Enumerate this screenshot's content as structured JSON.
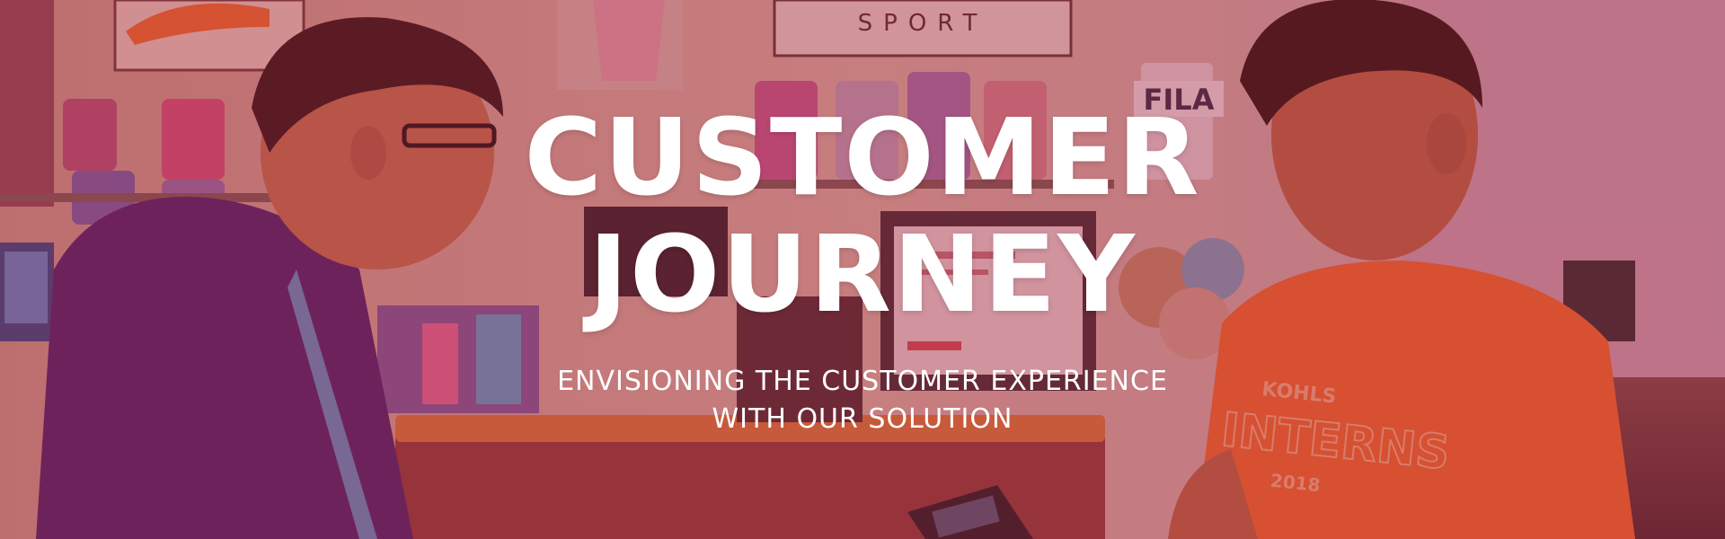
{
  "hero": {
    "title_line1": "CUSTOMER",
    "title_line2": "JOURNEY",
    "subtitle_line1": "ENVISIONING THE CUSTOMER EXPERIENCE",
    "subtitle_line2": "WITH OUR SOLUTION"
  },
  "photo": {
    "description_icon": "store-checkout-photo",
    "tshirt_print_line1": "KOHLS",
    "tshirt_print_line2": "INTERNS",
    "tshirt_print_line3": "2018",
    "sign_text": "FILA",
    "sign_text2": "SPORT"
  },
  "colors": {
    "overlay": "#aa283c",
    "text": "#ffffff",
    "orange_shirt": "#f06a2a",
    "purple_shirt": "#4a1f6e"
  }
}
